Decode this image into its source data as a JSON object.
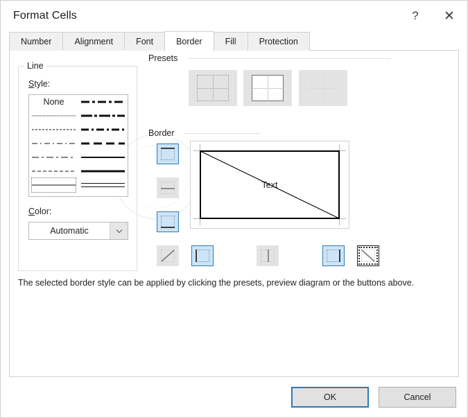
{
  "window": {
    "title": "Format Cells",
    "help_button": "?",
    "close_button": "✕",
    "help_icon_name": "help-icon",
    "close_icon_name": "close-icon"
  },
  "tabs": [
    {
      "label": "Number",
      "active": false
    },
    {
      "label": "Alignment",
      "active": false
    },
    {
      "label": "Font",
      "active": false
    },
    {
      "label": "Border",
      "active": true
    },
    {
      "label": "Fill",
      "active": false
    },
    {
      "label": "Protection",
      "active": false
    }
  ],
  "line_group": {
    "legend": "Line",
    "style_label": "Style:",
    "style_label_accesskey": "S",
    "color_label": "Color:",
    "color_label_accesskey": "C",
    "color_value": "Automatic",
    "color_dropdown_icon": "chevron-down-icon",
    "styles_left": [
      {
        "name": "none",
        "label": "None",
        "selected": false
      },
      {
        "name": "hairline-dotted",
        "label": "",
        "selected": false
      },
      {
        "name": "fine-dotted",
        "label": "",
        "selected": false
      },
      {
        "name": "dash-dot-fine",
        "label": "",
        "selected": false
      },
      {
        "name": "dash-dot",
        "label": "",
        "selected": false
      },
      {
        "name": "dashed-fine",
        "label": "",
        "selected": false
      },
      {
        "name": "thin-solid",
        "label": "",
        "selected": true
      }
    ],
    "styles_right": [
      {
        "name": "thick-dash-dot-dot",
        "label": "",
        "selected": false
      },
      {
        "name": "thick-dash-dot-long",
        "label": "",
        "selected": false
      },
      {
        "name": "thick-dash-dot",
        "label": "",
        "selected": false
      },
      {
        "name": "thick-dashed",
        "label": "",
        "selected": false
      },
      {
        "name": "medium-solid",
        "label": "",
        "selected": false
      },
      {
        "name": "thick-solid",
        "label": "",
        "selected": false
      },
      {
        "name": "double-line",
        "label": "",
        "selected": false
      }
    ]
  },
  "presets": {
    "label": "Presets",
    "buttons": [
      {
        "name": "preset-none",
        "icon": "border-none-icon",
        "state": "normal"
      },
      {
        "name": "preset-outline",
        "icon": "border-outline-icon",
        "state": "normal"
      },
      {
        "name": "preset-inside",
        "icon": "border-inside-icon",
        "state": "normal"
      }
    ]
  },
  "border": {
    "label": "Border",
    "preview_text": "Text",
    "buttons_left": [
      {
        "name": "border-top",
        "icon": "border-top-icon",
        "state": "active"
      },
      {
        "name": "border-horizontal-inside",
        "icon": "border-horizontal-icon",
        "state": "normal"
      },
      {
        "name": "border-bottom",
        "icon": "border-bottom-icon",
        "state": "active"
      },
      {
        "name": "border-diagonal-up",
        "icon": "border-diagonal-up-icon",
        "state": "normal"
      }
    ],
    "buttons_bottom": [
      {
        "name": "border-left",
        "icon": "border-left-icon",
        "state": "active"
      },
      {
        "name": "border-vertical-inside",
        "icon": "border-vertical-icon",
        "state": "normal"
      },
      {
        "name": "border-right",
        "icon": "border-right-icon",
        "state": "active"
      },
      {
        "name": "border-diagonal-down",
        "icon": "border-diagonal-down-icon",
        "state": "focused"
      }
    ],
    "preview_applied": {
      "top": true,
      "bottom": true,
      "left": true,
      "right": true,
      "diagonal_down": true
    }
  },
  "help_text": "The selected border style can be applied by clicking the presets, preview diagram or the buttons above.",
  "footer": {
    "ok_label": "OK",
    "cancel_label": "Cancel"
  },
  "colors": {
    "accent": "#2e79b8",
    "active_button_fill": "#cce4f7",
    "button_face": "#e3e3e3",
    "dialog_bg": "#ffffff",
    "border_line": "#d0d0d0"
  }
}
